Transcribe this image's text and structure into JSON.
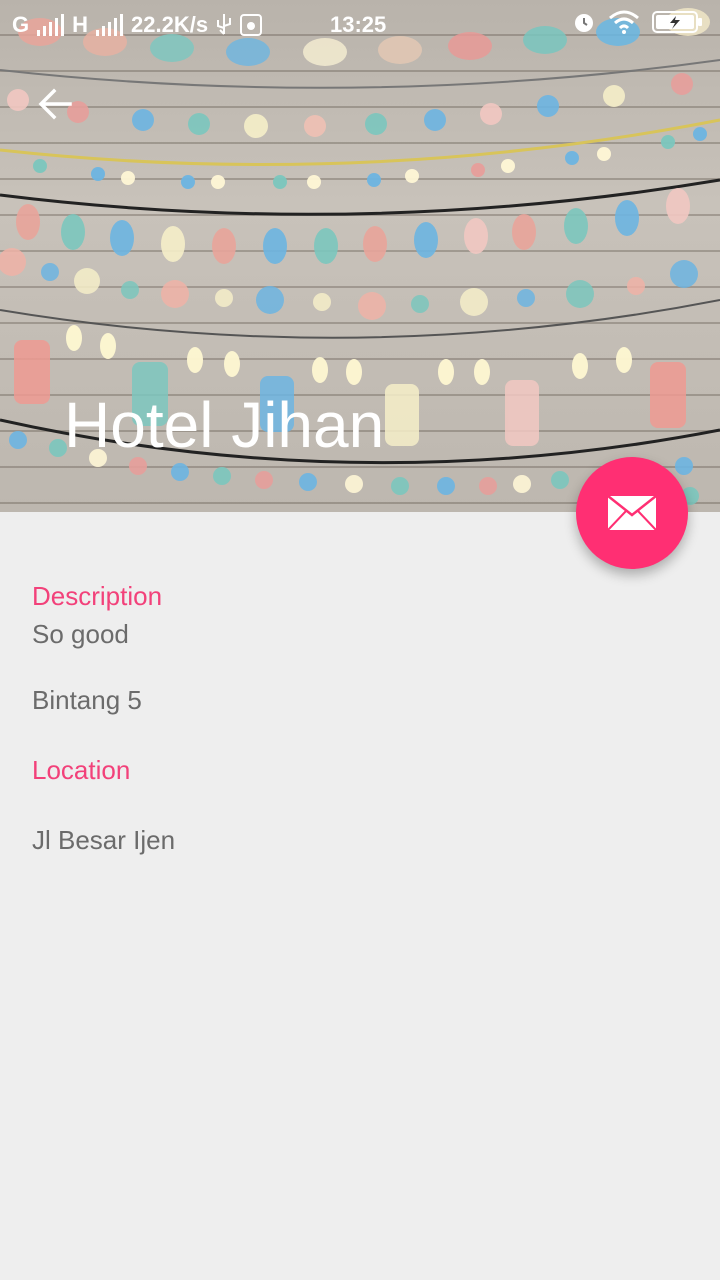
{
  "status_bar": {
    "network1": "G",
    "network2": "H",
    "speed": "22.2K/s",
    "time": "13:25"
  },
  "header": {
    "title": "Hotel Jihan"
  },
  "details": {
    "description_label": "Description",
    "description_value": "So good",
    "rating_value": "Bintang 5",
    "location_label": "Location",
    "location_value": "Jl Besar Ijen"
  },
  "colors": {
    "accent": "#ff2f73",
    "label": "#f2417a",
    "text": "#6b6b6b",
    "background": "#eeeeee"
  },
  "icons": {
    "back": "arrow-back-icon",
    "fab": "email-icon"
  }
}
